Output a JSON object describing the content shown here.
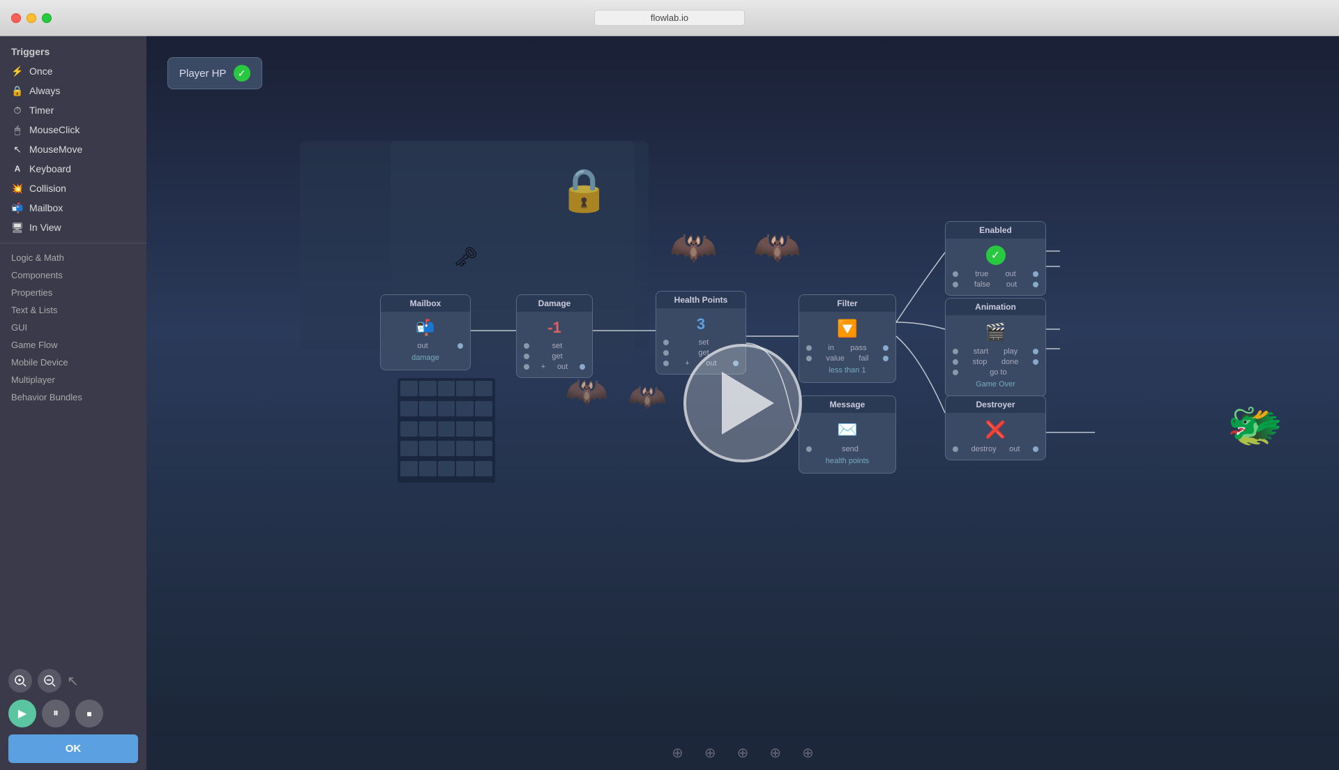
{
  "window": {
    "title": "flowlab.io"
  },
  "sidebar": {
    "section_triggers": "Triggers",
    "items_triggers": [
      {
        "label": "Once",
        "icon": "⚡"
      },
      {
        "label": "Always",
        "icon": "🔒"
      },
      {
        "label": "Timer",
        "icon": "⏱"
      },
      {
        "label": "MouseClick",
        "icon": "🖱"
      },
      {
        "label": "MouseMove",
        "icon": "↖"
      },
      {
        "label": "Keyboard",
        "icon": "A"
      },
      {
        "label": "Collision",
        "icon": "💥"
      },
      {
        "label": "Mailbox",
        "icon": "📬"
      },
      {
        "label": "In View",
        "icon": "🖥"
      }
    ],
    "categories": [
      "Logic & Math",
      "Components",
      "Properties",
      "Text & Lists",
      "GUI",
      "Game Flow",
      "Mobile Device",
      "Multiplayer",
      "Behavior Bundles"
    ],
    "ok_label": "OK"
  },
  "canvas": {
    "header": {
      "label": "Player HP",
      "check_icon": "✓"
    },
    "nodes": {
      "mailbox": {
        "title": "Mailbox",
        "port_out": "out",
        "label": "damage"
      },
      "damage": {
        "title": "Damage",
        "ports_in": [
          "set",
          "get",
          "+"
        ],
        "port_out": "out",
        "value": "-1"
      },
      "health_points": {
        "title": "Health Points",
        "ports_in": [
          "set",
          "get",
          "+"
        ],
        "port_out": "out",
        "value": "3"
      },
      "filter": {
        "title": "Filter",
        "ports_in": [
          "in",
          "value"
        ],
        "ports_out": [
          "pass",
          "fail"
        ],
        "label": "less than 1"
      },
      "enabled": {
        "title": "Enabled",
        "ports_out_true": "out",
        "ports_out_false": "out",
        "port_true": "true",
        "port_false": "false"
      },
      "animation": {
        "title": "Animation",
        "ports_in": [
          "start",
          "stop",
          "go to"
        ],
        "ports_out": [
          "play",
          "done"
        ],
        "label": "Game Over"
      },
      "message": {
        "title": "Message",
        "port_in": "send",
        "label": "health points"
      },
      "destroyer": {
        "title": "Destroyer",
        "port_in": "destroy",
        "port_out": "out"
      }
    }
  },
  "playback": {
    "play_label": "▶",
    "pause_label": "⏸",
    "stop_label": "⏹"
  },
  "zoom": {
    "zoom_in_label": "🔍+",
    "zoom_out_label": "🔍-"
  }
}
